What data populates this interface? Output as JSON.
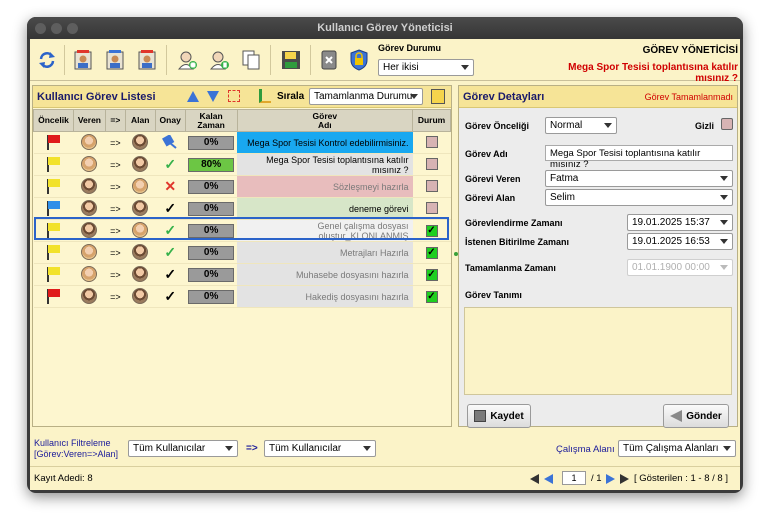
{
  "window": {
    "title": "Kullanıcı Görev Yöneticisi"
  },
  "toolbar": {
    "status_label": "Görev Durumu",
    "status_value": "Her ikisi",
    "manager_title": "GÖREV YÖNETİCİSİ",
    "current_task": "Mega Spor Tesisi toplantısına katılır mısınız ?",
    "icons": [
      "refresh-icon",
      "user-task-icon",
      "user-task-icon",
      "user-task-icon",
      "add-user-icon",
      "add-user-icon",
      "copy-icon",
      "save-icon",
      "delete-icon",
      "lock-icon"
    ]
  },
  "list": {
    "title": "Kullanıcı Görev Listesi",
    "sort_label": "Sırala",
    "sort_value": "Tamamlanma Durumu",
    "headers": {
      "priority": "Öncelik",
      "giver": "Veren",
      "arrow": "=>",
      "receiver": "Alan",
      "approval": "Onay",
      "remaining1": "Kalan",
      "remaining2": "Zaman",
      "task1": "Görev",
      "task2": "Adı",
      "status": "Durum"
    },
    "rows": [
      {
        "flag_color": "#e01b1b",
        "arrow": "=>",
        "approval": "pin",
        "remaining": "0%",
        "task": "Mega Spor Tesisi Kontrol edebilirmisiniz.",
        "done": false,
        "highlight": "#19a8f0",
        "text_color": "#000000",
        "giver": "f",
        "receiver": "m"
      },
      {
        "flag_color": "#f2e22b",
        "arrow": "=>",
        "approval": "check-green",
        "remaining": "80%",
        "task": "Mega Spor Tesisi toplantısına katılır mısınız ?",
        "done": false,
        "highlight": "#e3e3e3",
        "text_color": "#000000",
        "giver": "f",
        "receiver": "m"
      },
      {
        "flag_color": "#f2e22b",
        "arrow": "=>",
        "approval": "cross-red",
        "remaining": "0%",
        "task": "Sözleşmeyi hazırla",
        "done": false,
        "highlight": "#e8bdbd",
        "text_color": "#7a7a7a",
        "giver": "m",
        "receiver": "f"
      },
      {
        "flag_color": "#2f8fe8",
        "arrow": "=>",
        "approval": "check-black",
        "remaining": "0%",
        "task": "deneme görevi",
        "done": false,
        "highlight": "#d7e6c8",
        "text_color": "#000000",
        "giver": "m",
        "receiver": "m"
      },
      {
        "flag_color": "#f2e22b",
        "arrow": "=>",
        "approval": "check-green",
        "remaining": "0%",
        "task": "Genel çalışma dosyası oluştur_KLONLANMIŞ",
        "done": true,
        "highlight": "#f1f1f1",
        "text_color": "#7a7a7a",
        "giver": "m",
        "receiver": "f"
      },
      {
        "flag_color": "#f2e22b",
        "arrow": "=>",
        "approval": "check-green",
        "remaining": "0%",
        "task": "Metrajları Hazırla",
        "done": true,
        "highlight": "#e3e3e3",
        "text_color": "#7a7a7a",
        "giver": "f",
        "receiver": "m"
      },
      {
        "flag_color": "#f2e22b",
        "arrow": "=>",
        "approval": "check-black",
        "remaining": "0%",
        "task": "Muhasebe dosyasını hazırla",
        "done": true,
        "highlight": "#e3e3e3",
        "text_color": "#7a7a7a",
        "giver": "f",
        "receiver": "m"
      },
      {
        "flag_color": "#e01b1b",
        "arrow": "=>",
        "approval": "check-black",
        "remaining": "0%",
        "task": "Hakediş dosyasını hazırla",
        "done": true,
        "highlight": "#e3e3e3",
        "text_color": "#7a7a7a",
        "giver": "m",
        "receiver": "m"
      }
    ]
  },
  "detail": {
    "title": "Görev Detayları",
    "status": "Görev Tamamlanmadı",
    "priority_label": "Görev Önceliği",
    "priority_value": "Normal",
    "hidden_label": "Gizli",
    "name_label": "Görev Adı",
    "name_value": "Mega Spor Tesisi toplantısına katılır mısınız ?",
    "giver_label": "Görevi Veren",
    "giver_value": "Fatma",
    "receiver_label": "Görevi Alan",
    "receiver_value": "Selim",
    "assigned_label": "Görevlendirme Zamanı",
    "assigned_value": "19.01.2025 15:37",
    "due_label": "İstenen Bitirilme Zamanı",
    "due_value": "19.01.2025 16:53",
    "completed_label": "Tamamlanma Zamanı",
    "completed_value": "01.01.1900 00:00",
    "desc_label": "Görev Tanımı",
    "save_label": "Kaydet",
    "send_label": "Gönder"
  },
  "filter": {
    "label1": "Kullanıcı Filtreleme",
    "label2": "[Görev:Veren=>Alan]",
    "from_value": "Tüm Kullanıcılar",
    "arrow": "=>",
    "to_value": "Tüm Kullanıcılar",
    "area_label": "Çalışma Alanı",
    "area_value": "Tüm Çalışma Alanları"
  },
  "footer": {
    "count_label": "Kayıt Adedi: 8",
    "page_value": "1",
    "page_total": "/ 1",
    "shown": "[ Gösterilen :   1 - 8 / 8 ]"
  }
}
